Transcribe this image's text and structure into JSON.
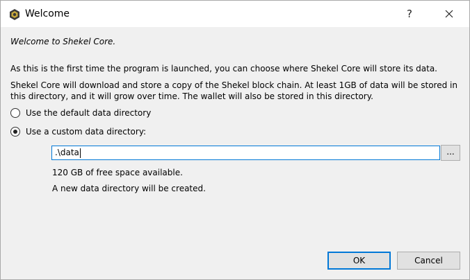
{
  "window": {
    "title": "Welcome",
    "help_label": "?"
  },
  "intro": {
    "welcome": "Welcome to Shekel Core.",
    "para1": "As this is the first time the program is launched, you can choose where Shekel Core will store its data.",
    "para2": "Shekel Core will download and store a copy of the Shekel block chain. At least 1GB of data will be stored in this directory, and it will grow over time. The wallet will also be stored in this directory."
  },
  "options": {
    "default_label": "Use the default data directory",
    "default_selected": false,
    "custom_label": "Use a custom data directory:",
    "custom_selected": true
  },
  "directory": {
    "value": ".\\data",
    "browse_label": "..."
  },
  "status": {
    "free_space": "120 GB of free space available.",
    "new_dir": "A new data directory will be created."
  },
  "buttons": {
    "ok": "OK",
    "cancel": "Cancel"
  },
  "colors": {
    "accent": "#0078d7",
    "background": "#f0f0f0"
  },
  "icons": {
    "app": "shekel-app-icon",
    "close": "close-icon"
  }
}
